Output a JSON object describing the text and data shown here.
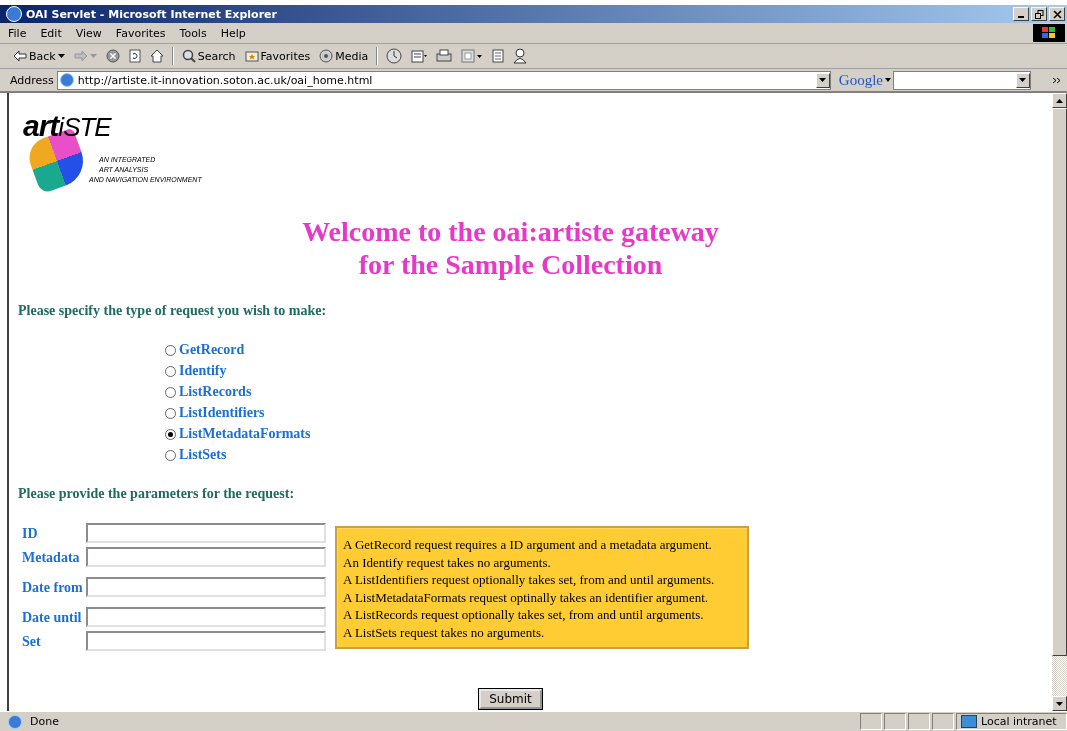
{
  "window": {
    "title": "OAI Servlet - Microsoft Internet Explorer"
  },
  "menu": [
    "File",
    "Edit",
    "View",
    "Favorites",
    "Tools",
    "Help"
  ],
  "toolbar": [
    {
      "kind": "back",
      "label": "Back"
    },
    {
      "kind": "forward"
    },
    {
      "kind": "stop"
    },
    {
      "kind": "refresh"
    },
    {
      "kind": "home"
    },
    {
      "kind": "search",
      "label": "Search"
    },
    {
      "kind": "favorites",
      "label": "Favorites"
    },
    {
      "kind": "media",
      "label": "Media"
    },
    {
      "kind": "history"
    },
    {
      "kind": "mail"
    },
    {
      "kind": "print"
    },
    {
      "kind": "edit"
    },
    {
      "kind": "discuss"
    },
    {
      "kind": "messenger"
    }
  ],
  "address": {
    "label": "Address",
    "url": "http://artiste.it-innovation.soton.ac.uk/oai_home.html",
    "google": "Google"
  },
  "logo": {
    "wordmark_start": "art",
    "wordmark_end": "iSTE",
    "tagline": [
      "AN INTEGRATED",
      "ART ANALYSIS",
      "AND NAVIGATION ENVIRONMENT"
    ]
  },
  "heading": [
    "Welcome to the oai:artiste gateway",
    "for the Sample Collection"
  ],
  "request_prompt": "Please specify the type of request you wish to make:",
  "requests": [
    {
      "label": "GetRecord",
      "selected": false
    },
    {
      "label": "Identify",
      "selected": false
    },
    {
      "label": "ListRecords",
      "selected": false
    },
    {
      "label": "ListIdentifiers",
      "selected": false
    },
    {
      "label": "ListMetadataFormats",
      "selected": true
    },
    {
      "label": "ListSets",
      "selected": false
    }
  ],
  "params_prompt": "Please provide the parameters for the request:",
  "params": [
    {
      "label": "ID"
    },
    {
      "label": "Metadata"
    },
    {
      "label": "Date from"
    },
    {
      "label": "Date until"
    },
    {
      "label": "Set"
    }
  ],
  "help": [
    "A GetRecord request requires a ID argument and a metadata argument.",
    "An Identify request takes no arguments.",
    "A ListIdentifiers request optionally takes set, from and until arguments.",
    "A ListMetadataFormats request optinally takes an identifier argument.",
    "A ListRecords request optionally takes set, from and until arguments.",
    "A ListSets request takes no arguments."
  ],
  "submit": "Submit",
  "status_bar": {
    "text": "Done",
    "zone": "Local intranet"
  }
}
